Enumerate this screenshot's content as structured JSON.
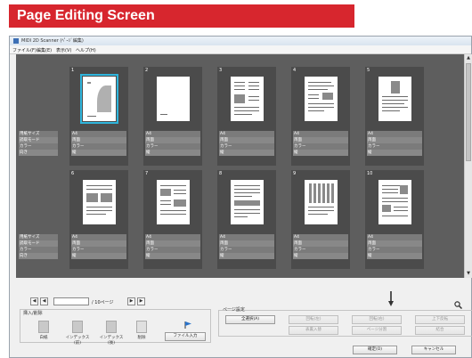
{
  "banner": {
    "title": "Page Editing Screen"
  },
  "window": {
    "title": "MIDI 2D Scanner (ﾍﾟｰｼﾞ編集)",
    "menu": [
      "ファイル(F)",
      "編集(E)",
      "表示(V)",
      "ヘルプ(H)"
    ]
  },
  "row_labels": [
    "用紙サイズ",
    "読取モード",
    "カラー",
    "向き"
  ],
  "cells": [
    {
      "num": "1",
      "props": [
        "A4",
        "両面",
        "カラー",
        "縦"
      ]
    },
    {
      "num": "2",
      "props": [
        "A4",
        "両面",
        "カラー",
        "縦"
      ]
    },
    {
      "num": "3",
      "props": [
        "A4",
        "両面",
        "カラー",
        "縦"
      ]
    },
    {
      "num": "4",
      "props": [
        "A4",
        "両面",
        "カラー",
        "縦"
      ]
    },
    {
      "num": "5",
      "props": [
        "A4",
        "両面",
        "カラー",
        "縦"
      ]
    },
    {
      "num": "6",
      "props": [
        "A4",
        "両面",
        "カラー",
        "縦"
      ]
    },
    {
      "num": "7",
      "props": [
        "A4",
        "両面",
        "カラー",
        "縦"
      ]
    },
    {
      "num": "8",
      "props": [
        "A4",
        "両面",
        "カラー",
        "縦"
      ]
    },
    {
      "num": "9",
      "props": [
        "A4",
        "両面",
        "カラー",
        "縦"
      ]
    },
    {
      "num": "10",
      "props": [
        "A4",
        "両面",
        "カラー",
        "縦"
      ]
    }
  ],
  "controls": {
    "page_suffix": "/ 10ページ",
    "left_group_label": "挿入/削除",
    "tools": [
      "白紙",
      "インデックス(前)",
      "インデックス(後)",
      "削除",
      "ファイル入力"
    ],
    "right_group_label": "ページ設定",
    "setting_buttons": [
      "全選択(A)",
      "回転(左)",
      "回転(右)",
      "上下反転",
      "表裏入替",
      "ページ分割",
      "結合"
    ],
    "ok_label": "確定(O)",
    "cancel_label": "キャンセル"
  },
  "colors": {
    "banner": "#d7262e",
    "selection": "#2fb5dc",
    "grid_bg": "#5e5e5e"
  },
  "icons": [
    "pen-icon",
    "zoom-icon"
  ]
}
